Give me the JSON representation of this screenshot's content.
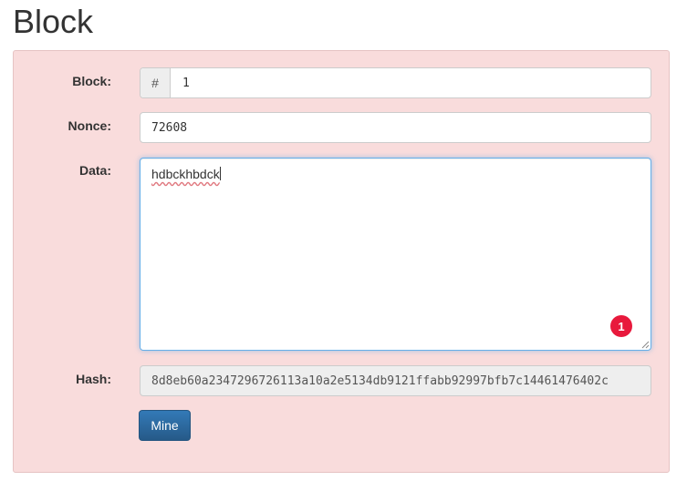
{
  "page": {
    "title": "Block"
  },
  "form": {
    "block": {
      "label": "Block:",
      "addon": "#",
      "value": "1"
    },
    "nonce": {
      "label": "Nonce:",
      "value": "72608"
    },
    "data": {
      "label": "Data:",
      "value": "hdbckhbdck",
      "error_count": "1"
    },
    "hash": {
      "label": "Hash:",
      "value": "8d8eb60a2347296726113a10a2e5134db9121ffabb92997bfb7c14461476402c"
    },
    "mine_label": "Mine"
  },
  "colors": {
    "panel_bg": "#f9dcdc",
    "button_primary": "#337ab7",
    "error_badge": "#e8193c"
  }
}
